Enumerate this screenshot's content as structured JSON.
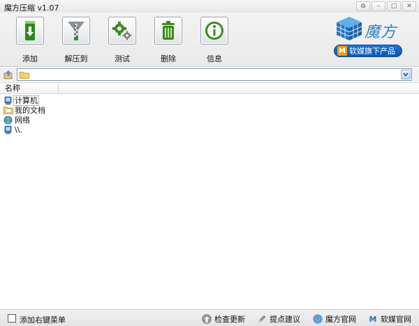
{
  "window": {
    "title": "魔方压缩  v1.07",
    "controls": {
      "restore": "⧉",
      "minimize": "–",
      "maximize": "□",
      "close": "✕"
    }
  },
  "toolbar": {
    "add_label": "添加",
    "extract_label": "解压到",
    "test_label": "测试",
    "delete_label": "删除",
    "info_label": "信息"
  },
  "brand": {
    "name": "魔方",
    "button_label": "软媒旗下产品",
    "button_mark": "M"
  },
  "path": {
    "value": ""
  },
  "list": {
    "column_name": "名称",
    "items": [
      {
        "label": "计算机",
        "icon": "computer-icon"
      },
      {
        "label": "我的文档",
        "icon": "documents-icon"
      },
      {
        "label": "网络",
        "icon": "network-icon"
      },
      {
        "label": "\\\\.",
        "icon": "computer-icon"
      }
    ]
  },
  "status": {
    "context_menu_label": "添加右键菜单",
    "check_update": "检查更新",
    "feedback": "提点建议",
    "official_site": "魔方官网",
    "ruanmei_site": "软媒官网"
  },
  "colors": {
    "accent": "#2d7fc6",
    "brand_button": "#0b57b0",
    "icon_green": "#3d8a1f"
  }
}
